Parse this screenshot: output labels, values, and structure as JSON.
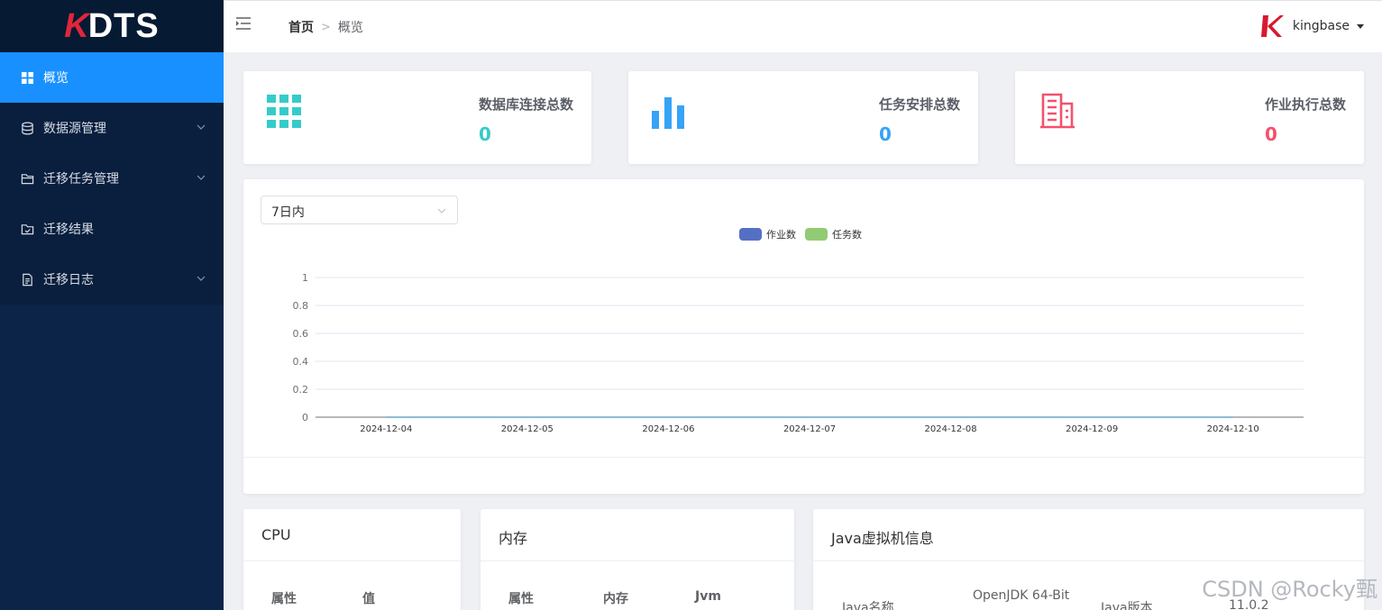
{
  "app": {
    "logo_k": "K",
    "logo_rest": "DTS"
  },
  "sidebar": {
    "items": [
      {
        "label": "概览",
        "icon": "grid-icon",
        "active": true
      },
      {
        "label": "数据源管理",
        "icon": "database-icon",
        "has_children": true
      },
      {
        "label": "迁移任务管理",
        "icon": "folder-icon",
        "has_children": true
      },
      {
        "label": "迁移结果",
        "icon": "checkbox-icon",
        "has_children": false
      },
      {
        "label": "迁移日志",
        "icon": "document-icon",
        "has_children": true
      }
    ]
  },
  "header": {
    "breadcrumb_home": "首页",
    "breadcrumb_sep": ">",
    "breadcrumb_current": "概览",
    "user_name": "kingbase"
  },
  "stats": [
    {
      "label": "数据库连接总数",
      "value": "0",
      "color": "#36cbcb",
      "icon": "grid-tiles-icon"
    },
    {
      "label": "任务安排总数",
      "value": "0",
      "color": "#36a3f7",
      "icon": "bar-chart-icon"
    },
    {
      "label": "作业执行总数",
      "value": "0",
      "color": "#f4516c",
      "icon": "building-icon"
    }
  ],
  "chart": {
    "range_select": "7日内",
    "legend": [
      {
        "name": "作业数",
        "color": "#5470c6"
      },
      {
        "name": "任务数",
        "color": "#91cc75"
      }
    ]
  },
  "chart_data": {
    "type": "line",
    "x": [
      "2024-12-04",
      "2024-12-05",
      "2024-12-06",
      "2024-12-07",
      "2024-12-08",
      "2024-12-09",
      "2024-12-10"
    ],
    "series": [
      {
        "name": "作业数",
        "values": [
          0,
          0,
          0,
          0,
          0,
          0,
          0
        ]
      },
      {
        "name": "任务数",
        "values": [
          0,
          0,
          0,
          0,
          0,
          0,
          0
        ]
      }
    ],
    "yticks": [
      "0",
      "0.2",
      "0.4",
      "0.6",
      "0.8",
      "1"
    ],
    "ylim": [
      0,
      1
    ],
    "grid": true,
    "legend_position": "top-center"
  },
  "panels": {
    "cpu": {
      "title": "CPU",
      "col1": "属性",
      "col2": "值"
    },
    "memory": {
      "title": "内存",
      "col1": "属性",
      "col2": "内存",
      "col3": "Jvm"
    },
    "jvm": {
      "title": "Java虚拟机信息",
      "name_label": "Java名称",
      "name_value": "OpenJDK 64-Bit",
      "version_label": "Java版本",
      "version_value": "11.0.2"
    }
  },
  "watermark": "CSDN @Rocky甄"
}
